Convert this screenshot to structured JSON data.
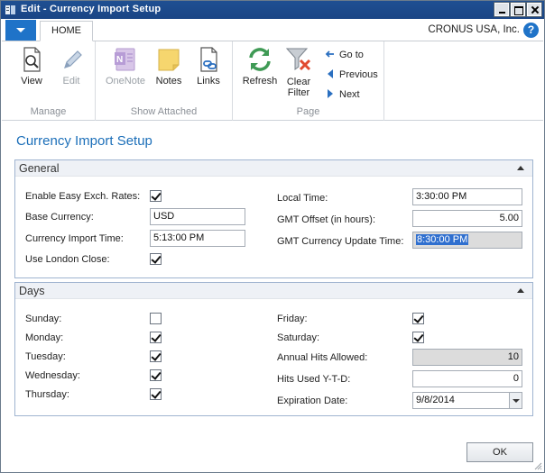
{
  "window": {
    "title": "Edit - Currency Import Setup"
  },
  "tabs": {
    "home": "HOME",
    "company": "CRONUS USA, Inc."
  },
  "ribbon": {
    "manage": {
      "label": "Manage",
      "view": "View",
      "edit": "Edit"
    },
    "show_attached": {
      "label": "Show Attached",
      "onenote": "OneNote",
      "notes": "Notes",
      "links": "Links"
    },
    "page": {
      "label": "Page",
      "refresh": "Refresh",
      "clear_filter_line1": "Clear",
      "clear_filter_line2": "Filter",
      "go_to": "Go to",
      "previous": "Previous",
      "next": "Next"
    }
  },
  "page_title": "Currency Import Setup",
  "general": {
    "header": "General",
    "enable_easy_label": "Enable Easy Exch. Rates:",
    "enable_easy_checked": true,
    "base_currency_label": "Base Currency:",
    "base_currency_value": "USD",
    "import_time_label": "Currency Import Time:",
    "import_time_value": "5:13:00 PM",
    "london_close_label": "Use London Close:",
    "london_close_checked": true,
    "local_time_label": "Local Time:",
    "local_time_value": "3:30:00 PM",
    "gmt_offset_label": "GMT Offset (in hours):",
    "gmt_offset_value": "5.00",
    "gmt_update_label": "GMT Currency Update Time:",
    "gmt_update_value": "8:30:00 PM"
  },
  "days": {
    "header": "Days",
    "sunday_label": "Sunday:",
    "sunday_checked": false,
    "monday_label": "Monday:",
    "monday_checked": true,
    "tuesday_label": "Tuesday:",
    "tuesday_checked": true,
    "wednesday_label": "Wednesday:",
    "wednesday_checked": true,
    "thursday_label": "Thursday:",
    "thursday_checked": true,
    "friday_label": "Friday:",
    "friday_checked": true,
    "saturday_label": "Saturday:",
    "saturday_checked": true,
    "annual_hits_label": "Annual Hits Allowed:",
    "annual_hits_value": "10",
    "hits_used_label": "Hits Used Y-T-D:",
    "hits_used_value": "0",
    "expiration_label": "Expiration Date:",
    "expiration_value": "9/8/2014"
  },
  "ok_label": "OK",
  "colors": {
    "title_bar": "#1f4f92",
    "accent": "#1c6fb9",
    "app_button": "#1f73c8"
  }
}
